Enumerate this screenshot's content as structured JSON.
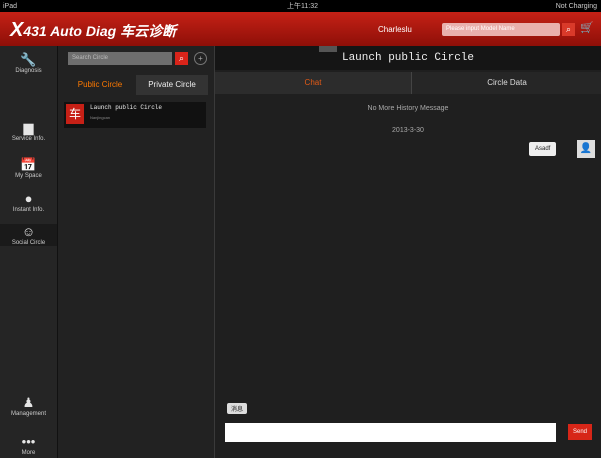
{
  "statusbar": {
    "left": "iPad",
    "time": "上午11:32",
    "right": "Not Charging"
  },
  "app": {
    "title_prefix": "X",
    "title": "431 Auto Diag 车云诊断"
  },
  "header": {
    "username": "Charleslu",
    "search_placeholder": "Please input Model Name"
  },
  "nav": [
    {
      "label": "Diagnosis",
      "icon": "wrench-icon",
      "glyph": "🔧"
    },
    {
      "label": "Service Info.",
      "icon": "folder-icon",
      "glyph": "▆"
    },
    {
      "label": "My Space",
      "icon": "calendar-icon",
      "glyph": "📅"
    },
    {
      "label": "Instant Info.",
      "icon": "chat-bubble-icon",
      "glyph": "●"
    },
    {
      "label": "Social Circle",
      "icon": "smile-icon",
      "glyph": "☺"
    },
    {
      "label": "Management",
      "icon": "person-icon",
      "glyph": "♟"
    },
    {
      "label": "More",
      "icon": "ellipsis-icon",
      "glyph": "•••"
    }
  ],
  "circle": {
    "search_placeholder": "Search Circle",
    "tabs": [
      "Public Circle",
      "Private Circle"
    ],
    "items": [
      {
        "name": "Launch public Circle",
        "sub": "Nanjingcan",
        "avatar_glyph": "车"
      }
    ]
  },
  "chat": {
    "title": "Launch public Circle",
    "tabs": [
      "Chat",
      "Circle Data"
    ],
    "no_history": "No More History Message",
    "date": "2013-3-30",
    "messages": [
      {
        "text": "Asadf"
      }
    ],
    "tag_chip": "消息",
    "send_label": "Send"
  }
}
